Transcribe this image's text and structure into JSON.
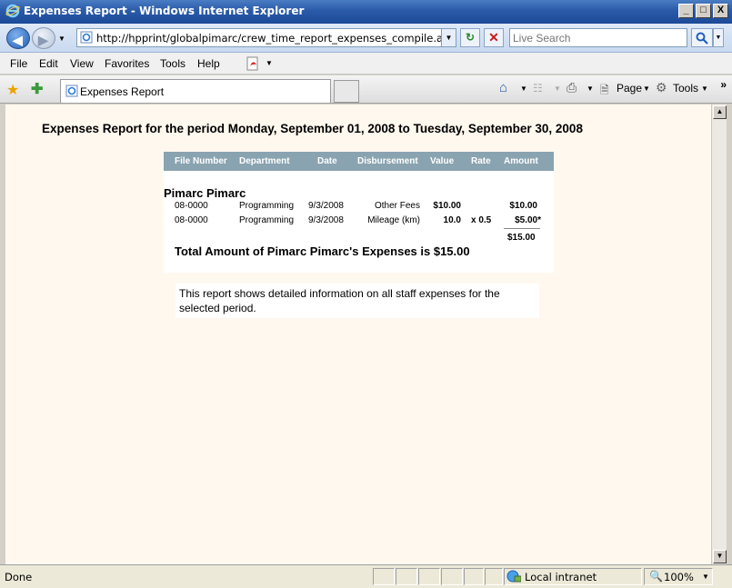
{
  "window": {
    "title": "Expenses Report - Windows Internet Explorer",
    "minimize": "_",
    "maximize": "□",
    "close": "X"
  },
  "nav": {
    "url": "http://hpprint/globalpimarc/crew_time_report_expenses_compile.asp",
    "search_placeholder": "Live Search"
  },
  "menu": {
    "items": [
      "File",
      "Edit",
      "View",
      "Favorites",
      "Tools",
      "Help"
    ]
  },
  "tabs": {
    "active_label": "Expenses Report"
  },
  "commandbar": {
    "page_label": "Page",
    "tools_label": "Tools"
  },
  "report": {
    "title": "Expenses Report for the period Monday, September 01, 2008 to Tuesday, September 30, 2008",
    "columns": [
      "File Number",
      "Department",
      "Date",
      "Disbursement",
      "Value",
      "Rate",
      "Amount"
    ],
    "employee": "Pimarc Pimarc",
    "rows": [
      {
        "file_number": "08-0000",
        "department": "Programming",
        "date": "9/3/2008",
        "disbursement": "Other Fees",
        "value": "$10.00",
        "rate": "",
        "amount": "$10.00"
      },
      {
        "file_number": "08-0000",
        "department": "Programming",
        "date": "9/3/2008",
        "disbursement": "Mileage (km)",
        "value": "10.0",
        "rate": "x 0.5",
        "amount": "$5.00*"
      }
    ],
    "subtotal": "$15.00",
    "total_text": "Total Amount of Pimarc Pimarc's Expenses is $15.00",
    "note": "This report shows detailed information on all staff expenses for the selected period."
  },
  "status": {
    "text": "Done",
    "zone": "Local intranet",
    "zoom": "100%"
  },
  "colors": {
    "table_header": "#8aa3b0",
    "page_background": "#fff8ee"
  }
}
